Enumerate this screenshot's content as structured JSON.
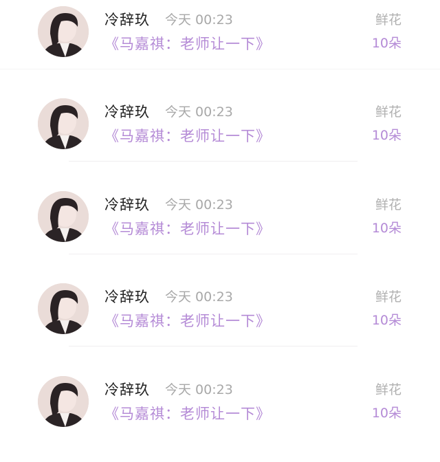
{
  "messages": [
    {
      "sender": "冷辞玖",
      "time": "今天 00:23",
      "work": "《马嘉祺：老师让一下》",
      "gift": "鲜花",
      "count": "10朵"
    },
    {
      "sender": "冷辞玖",
      "time": "今天 00:23",
      "work": "《马嘉祺：老师让一下》",
      "gift": "鲜花",
      "count": "10朵"
    },
    {
      "sender": "冷辞玖",
      "time": "今天 00:23",
      "work": "《马嘉祺：老师让一下》",
      "gift": "鲜花",
      "count": "10朵"
    },
    {
      "sender": "冷辞玖",
      "time": "今天 00:23",
      "work": "《马嘉祺：老师让一下》",
      "gift": "鲜花",
      "count": "10朵"
    },
    {
      "sender": "冷辞玖",
      "time": "今天 00:23",
      "work": "《马嘉祺：老师让一下》",
      "gift": "鲜花",
      "count": "10朵"
    }
  ],
  "colors": {
    "accent": "#b48ad6",
    "name": "#222222",
    "muted": "#a8a8a8"
  },
  "icons": {
    "avatar": "user-avatar-photo"
  }
}
